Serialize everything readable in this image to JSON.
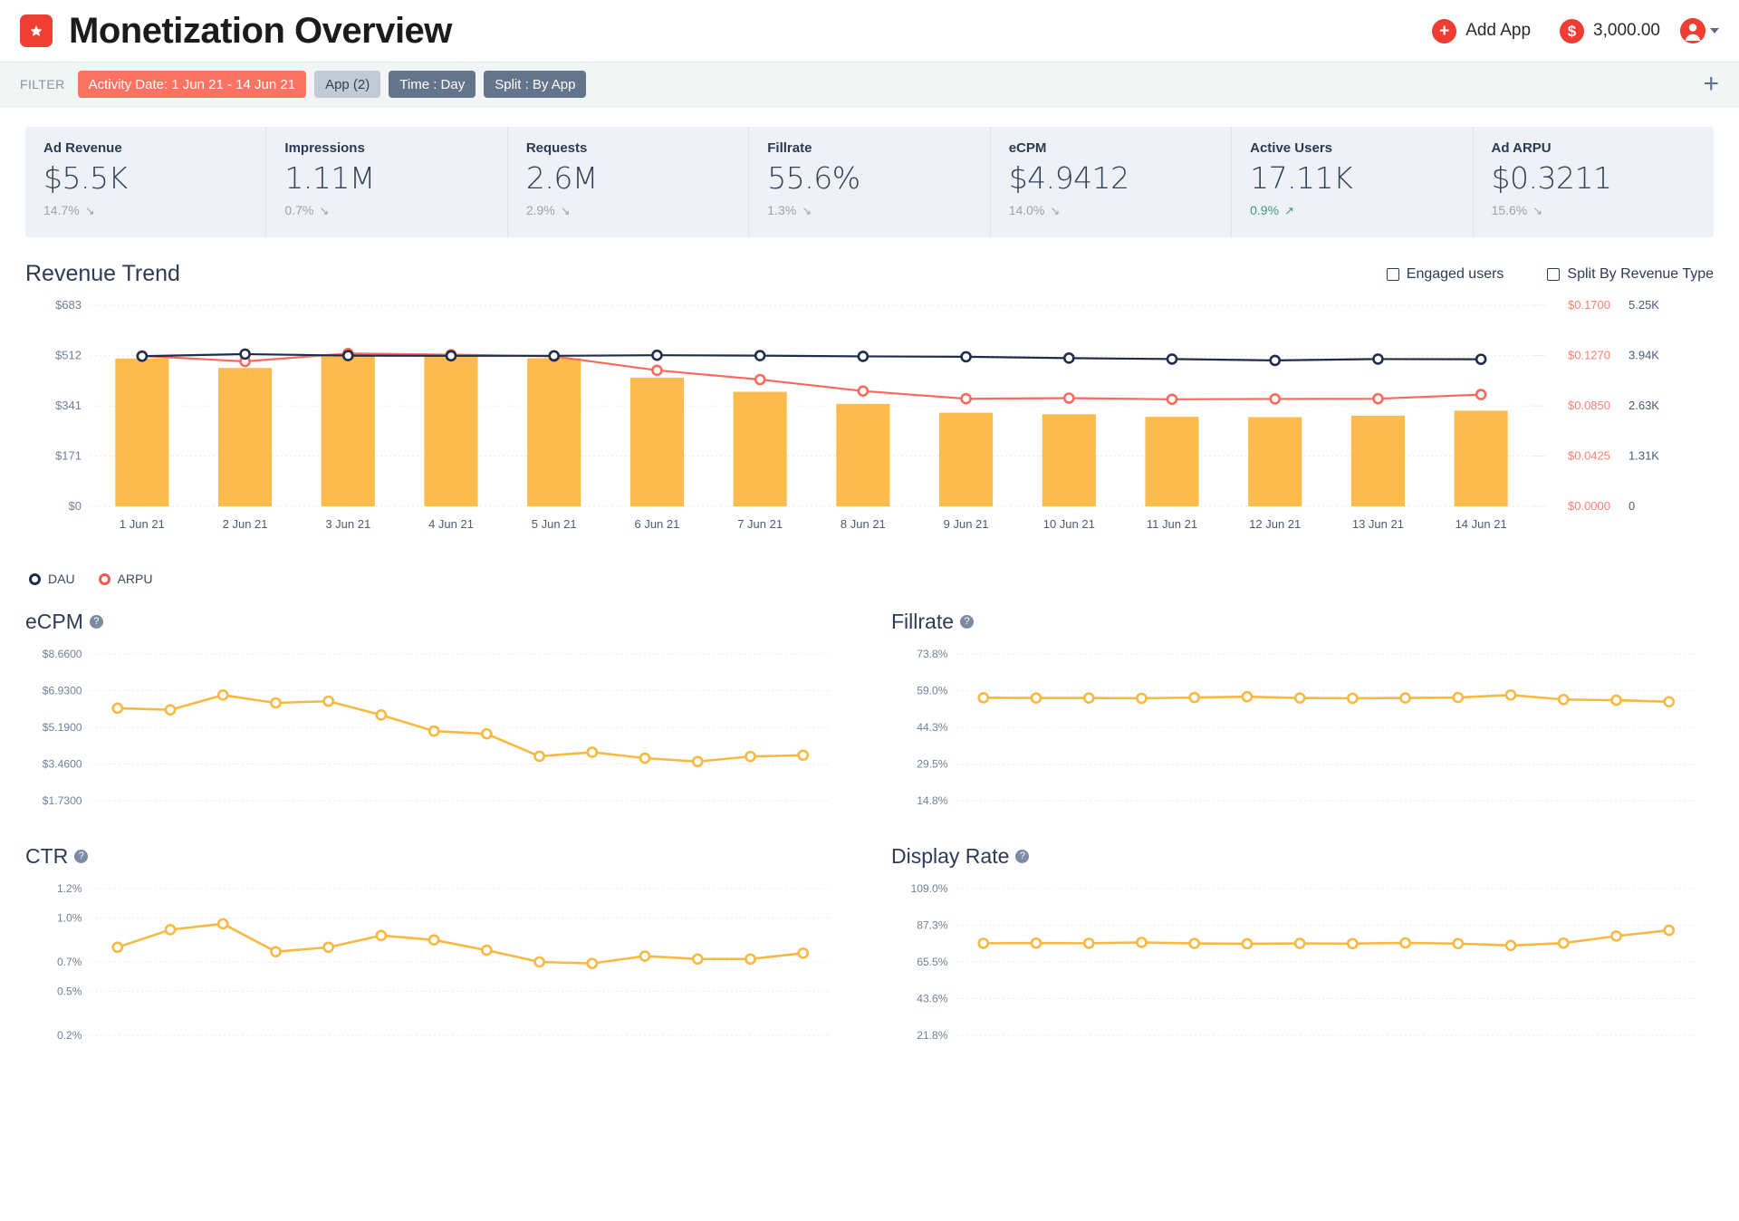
{
  "header": {
    "logo_icon": "star-badge-icon",
    "title": "Monetization Overview",
    "add_app_label": "Add App",
    "add_app_icon": "plus-circle-icon",
    "balance": "3,000.00",
    "balance_icon": "dollar-circle-icon",
    "avatar_icon": "user-avatar-icon",
    "caret_icon": "chevron-down-icon"
  },
  "filter": {
    "label": "FILTER",
    "chips": [
      {
        "text": "Activity Date: 1 Jun 21 - 14 Jun 21",
        "style": "red"
      },
      {
        "text": "App (2)",
        "style": "light"
      },
      {
        "text": "Time : Day",
        "style": "dark"
      },
      {
        "text": "Split : By App",
        "style": "dark"
      }
    ],
    "add_filter_icon": "plus-icon"
  },
  "kpis": [
    {
      "title": "Ad Revenue",
      "value": "$5.5K",
      "delta": "14.7%",
      "direction": "down"
    },
    {
      "title": "Impressions",
      "value": "1.11M",
      "delta": "0.7%",
      "direction": "down"
    },
    {
      "title": "Requests",
      "value": "2.6M",
      "delta": "2.9%",
      "direction": "down"
    },
    {
      "title": "Fillrate",
      "value": "55.6%",
      "delta": "1.3%",
      "direction": "down"
    },
    {
      "title": "eCPM",
      "value": "$4.9412",
      "delta": "14.0%",
      "direction": "down"
    },
    {
      "title": "Active Users",
      "value": "17.11K",
      "delta": "0.9%",
      "direction": "up"
    },
    {
      "title": "Ad ARPU",
      "value": "$0.3211",
      "delta": "15.6%",
      "direction": "down"
    }
  ],
  "revenue_trend": {
    "title": "Revenue Trend",
    "options": [
      {
        "label": "Engaged users",
        "checked": false
      },
      {
        "label": "Split By Revenue Type",
        "checked": false
      }
    ],
    "legend": [
      {
        "label": "DAU",
        "color": "#1e2d49"
      },
      {
        "label": "ARPU",
        "color": "#f8584c"
      }
    ]
  },
  "chart_data": [
    {
      "type": "bar",
      "name": "revenue-trend",
      "title": "Revenue Trend",
      "categories": [
        "1 Jun 21",
        "2 Jun 21",
        "3 Jun 21",
        "4 Jun 21",
        "5 Jun 21",
        "6 Jun 21",
        "7 Jun 21",
        "8 Jun 21",
        "9 Jun 21",
        "10 Jun 21",
        "11 Jun 21",
        "12 Jun 21",
        "13 Jun 21",
        "14 Jun 21"
      ],
      "values": [
        502,
        470,
        516,
        512,
        503,
        437,
        389,
        348,
        318,
        313,
        304,
        303,
        308,
        325
      ],
      "ylabel": "",
      "ylim": [
        0,
        683
      ],
      "yticks": [
        0,
        171,
        341,
        512,
        683
      ],
      "yticklabels": [
        "$0",
        "$171",
        "$341",
        "$512",
        "$683"
      ],
      "y2ticks": [
        0,
        0.0425,
        0.085,
        0.127,
        0.17
      ],
      "y2ticklabels": [
        "$0.0000",
        "$0.0425",
        "$0.0850",
        "$0.1270",
        "$0.1700"
      ],
      "y3ticks": [
        0,
        1310,
        2630,
        3940,
        5250
      ],
      "y3ticklabels": [
        "0",
        "1.31K",
        "2.63K",
        "3.94K",
        "5.25K"
      ],
      "grid": true,
      "legend_position": "bottom-left",
      "series": [
        {
          "name": "DAU",
          "axis": "right-2",
          "color": "#1e2d49",
          "values": [
            3920,
            3975,
            3935,
            3930,
            3930,
            3945,
            3935,
            3915,
            3905,
            3870,
            3845,
            3810,
            3845,
            3840
          ]
        },
        {
          "name": "ARPU",
          "axis": "right-1",
          "color": "#f8584c",
          "values": [
            0.1272,
            0.1225,
            0.1292,
            0.1282,
            0.1268,
            0.115,
            0.1072,
            0.0975,
            0.091,
            0.0915,
            0.0905,
            0.0908,
            0.091,
            0.0945
          ]
        }
      ]
    },
    {
      "type": "line",
      "name": "ecpm",
      "title": "eCPM",
      "categories": [
        "1 Jun 21",
        "2 Jun 21",
        "3 Jun 21",
        "4 Jun 21",
        "5 Jun 21",
        "6 Jun 21",
        "7 Jun 21",
        "8 Jun 21",
        "9 Jun 21",
        "10 Jun 21",
        "11 Jun 21",
        "12 Jun 21",
        "13 Jun 21",
        "14 Jun 21"
      ],
      "values": [
        6.1,
        6.02,
        6.72,
        6.35,
        6.43,
        5.78,
        5.02,
        4.89,
        3.83,
        4.02,
        3.74,
        3.58,
        3.82,
        3.88
      ],
      "color": "#f7b942",
      "ylim": [
        1.73,
        8.66
      ],
      "yticks": [
        1.73,
        3.46,
        5.19,
        6.93,
        8.66
      ],
      "yticklabels": [
        "$1.7300",
        "$3.4600",
        "$5.1900",
        "$6.9300",
        "$8.6600"
      ],
      "grid": true
    },
    {
      "type": "line",
      "name": "fillrate",
      "title": "Fillrate",
      "categories": [
        "1 Jun 21",
        "2 Jun 21",
        "3 Jun 21",
        "4 Jun 21",
        "5 Jun 21",
        "6 Jun 21",
        "7 Jun 21",
        "8 Jun 21",
        "9 Jun 21",
        "10 Jun 21",
        "11 Jun 21",
        "12 Jun 21",
        "13 Jun 21",
        "14 Jun 21"
      ],
      "values": [
        56.2,
        56.1,
        56.1,
        56.0,
        56.3,
        56.6,
        56.1,
        56.0,
        56.1,
        56.3,
        57.3,
        55.5,
        55.2,
        54.6
      ],
      "color": "#f7b942",
      "ylim": [
        14.8,
        73.8
      ],
      "yticks": [
        14.8,
        29.5,
        44.3,
        59.0,
        73.8
      ],
      "yticklabels": [
        "14.8%",
        "29.5%",
        "44.3%",
        "59.0%",
        "73.8%"
      ],
      "grid": true
    },
    {
      "type": "line",
      "name": "ctr",
      "title": "CTR",
      "categories": [
        "1 Jun 21",
        "2 Jun 21",
        "3 Jun 21",
        "4 Jun 21",
        "5 Jun 21",
        "6 Jun 21",
        "7 Jun 21",
        "8 Jun 21",
        "9 Jun 21",
        "10 Jun 21",
        "11 Jun 21",
        "12 Jun 21",
        "13 Jun 21",
        "14 Jun 21"
      ],
      "values": [
        0.8,
        0.92,
        0.96,
        0.77,
        0.8,
        0.88,
        0.85,
        0.78,
        0.7,
        0.69,
        0.74,
        0.72,
        0.72,
        0.76
      ],
      "color": "#f7b942",
      "ylim": [
        0.2,
        1.2
      ],
      "yticks": [
        0.2,
        0.5,
        0.7,
        1.0,
        1.2
      ],
      "yticklabels": [
        "0.2%",
        "0.5%",
        "0.7%",
        "1.0%",
        "1.2%"
      ],
      "grid": true
    },
    {
      "type": "line",
      "name": "display-rate",
      "title": "Display Rate",
      "categories": [
        "1 Jun 21",
        "2 Jun 21",
        "3 Jun 21",
        "4 Jun 21",
        "5 Jun 21",
        "6 Jun 21",
        "7 Jun 21",
        "8 Jun 21",
        "9 Jun 21",
        "10 Jun 21",
        "11 Jun 21",
        "12 Jun 21",
        "13 Jun 21",
        "14 Jun 21"
      ],
      "values": [
        76.5,
        76.6,
        76.5,
        77.0,
        76.4,
        76.2,
        76.4,
        76.3,
        76.7,
        76.3,
        75.2,
        76.6,
        80.8,
        84.2
      ],
      "color": "#f7b942",
      "ylim": [
        21.8,
        109.0
      ],
      "yticks": [
        21.8,
        43.6,
        65.5,
        87.3,
        109.0
      ],
      "yticklabels": [
        "21.8%",
        "43.6%",
        "65.5%",
        "87.3%",
        "109.0%"
      ],
      "grid": true
    }
  ],
  "small_charts": [
    {
      "title": "eCPM",
      "help_icon": "help-icon"
    },
    {
      "title": "Fillrate",
      "help_icon": "help-icon"
    },
    {
      "title": "CTR",
      "help_icon": "help-icon"
    },
    {
      "title": "Display Rate",
      "help_icon": "help-icon"
    }
  ]
}
